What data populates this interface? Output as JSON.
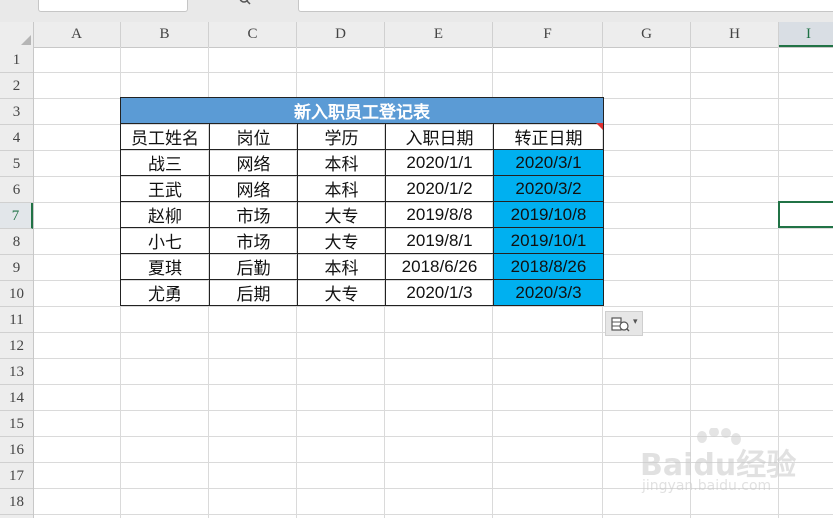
{
  "columns": [
    "A",
    "B",
    "C",
    "D",
    "E",
    "F",
    "G",
    "H",
    "I"
  ],
  "rows": [
    "1",
    "2",
    "3",
    "4",
    "5",
    "6",
    "7",
    "8",
    "9",
    "10",
    "11",
    "12",
    "13",
    "14",
    "15",
    "16",
    "17",
    "18"
  ],
  "active_cell": {
    "column": "I",
    "row": "7"
  },
  "table": {
    "title": "新入职员工登记表",
    "headers": [
      "员工姓名",
      "岗位",
      "学历",
      "入职日期",
      "转正日期"
    ],
    "rows": [
      [
        "战三",
        "网络",
        "本科",
        "2020/1/1",
        "2020/3/1"
      ],
      [
        "王武",
        "网络",
        "本科",
        "2020/1/2",
        "2020/3/2"
      ],
      [
        "赵柳",
        "市场",
        "大专",
        "2019/8/8",
        "2019/10/8"
      ],
      [
        "小七",
        "市场",
        "大专",
        "2019/8/1",
        "2019/10/1"
      ],
      [
        "夏琪",
        "后勤",
        "本科",
        "2018/6/26",
        "2018/8/26"
      ],
      [
        "尤勇",
        "后期",
        "大专",
        "2020/1/3",
        "2020/3/3"
      ]
    ]
  },
  "colors": {
    "title_fill": "#5b9bd5",
    "highlight_fill": "#00b0f0",
    "selection": "#217346"
  },
  "icons": {
    "paste_options": "paste-options-icon",
    "search": "search-icon"
  },
  "watermark": {
    "logo": "Baidu经验",
    "url": "jingyan.baidu.com"
  }
}
